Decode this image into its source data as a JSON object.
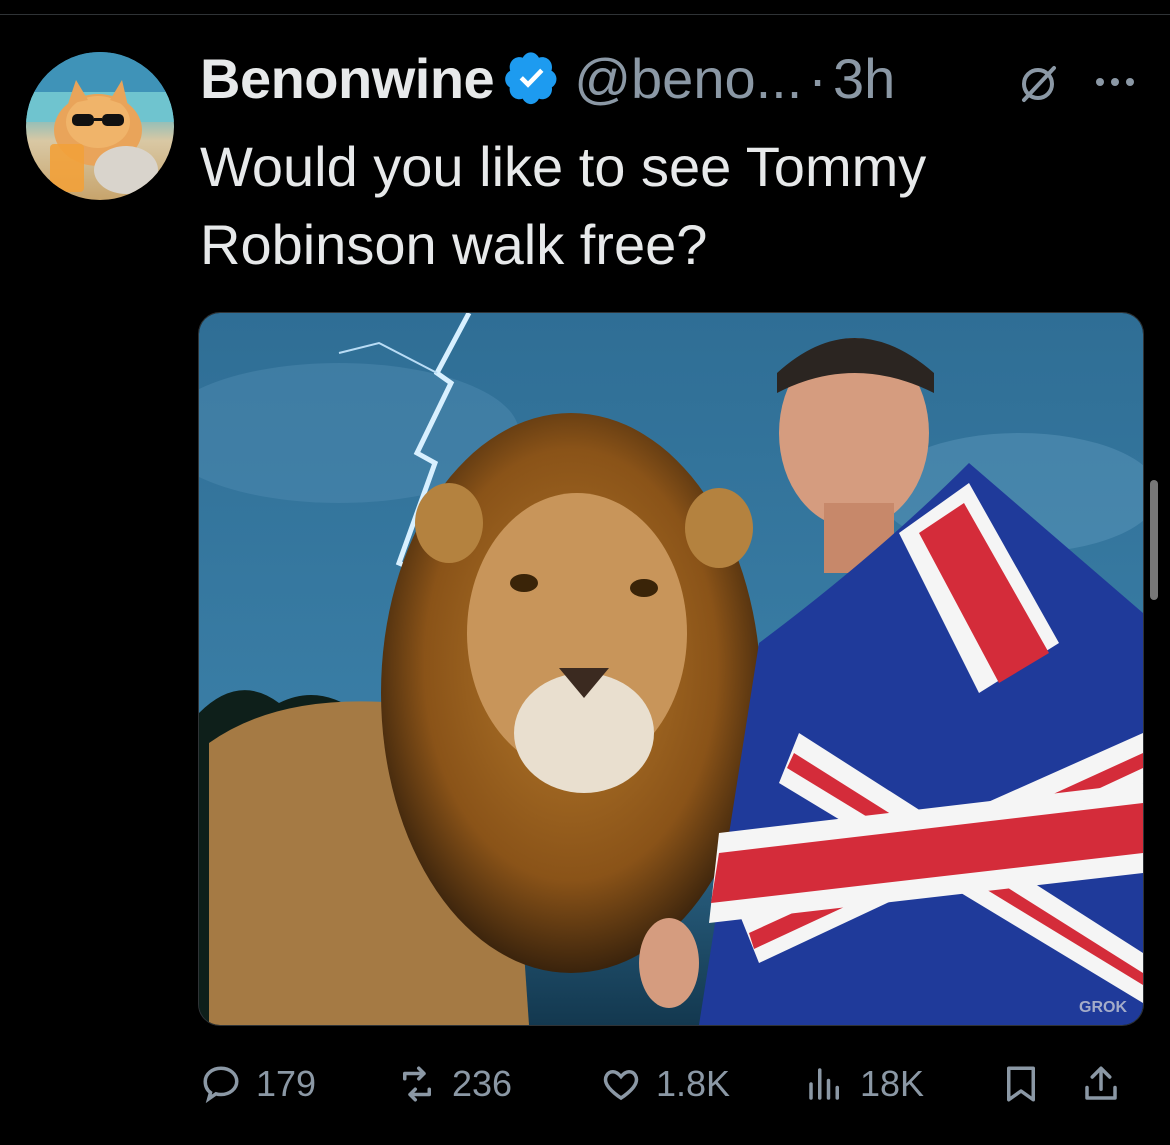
{
  "post": {
    "author_name": "Benonwine",
    "handle": "@beno...",
    "separator": "·",
    "time": "3h",
    "text": "Would you like to see Tommy Robinson walk free?",
    "media_watermark": "GROK"
  },
  "actions": {
    "replies": "179",
    "reposts": "236",
    "likes": "1.8K",
    "views": "18K"
  },
  "icons": [
    "verified-badge-icon",
    "grok-icon",
    "more-icon",
    "reply-icon",
    "repost-icon",
    "like-icon",
    "views-icon",
    "bookmark-icon",
    "share-icon"
  ],
  "colors": {
    "background": "#000000",
    "text": "#e7e9ea",
    "secondary": "#8b98a5",
    "verified": "#1d9bf0"
  }
}
